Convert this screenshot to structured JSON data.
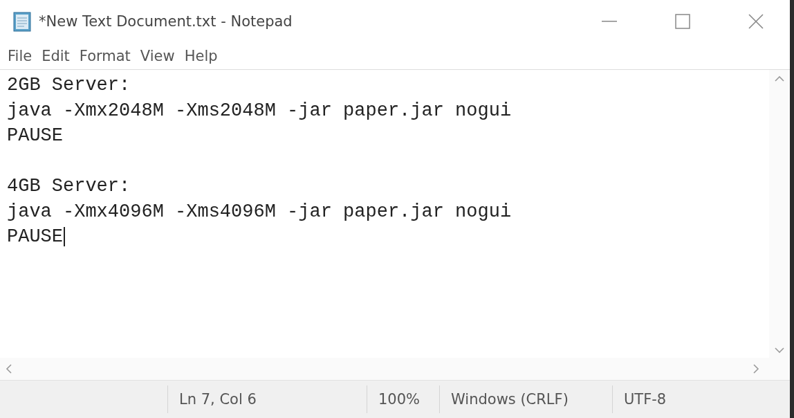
{
  "window": {
    "title": "*New Text Document.txt - Notepad"
  },
  "menu": [
    {
      "label": "File"
    },
    {
      "label": "Edit"
    },
    {
      "label": "Format"
    },
    {
      "label": "View"
    },
    {
      "label": "Help"
    }
  ],
  "editor": {
    "blocks": [
      {
        "lines": [
          "2GB Server:",
          "java -Xmx2048M -Xms2048M -jar paper.jar nogui",
          "PAUSE"
        ]
      },
      {
        "lines": [
          "4GB Server:",
          "java -Xmx4096M -Xms4096M -jar paper.jar nogui",
          "PAUSE"
        ]
      }
    ]
  },
  "status_bar": {
    "position": "Ln 7, Col 6",
    "zoom": "100%",
    "line_ending": "Windows (CRLF)",
    "encoding": "UTF-8"
  }
}
